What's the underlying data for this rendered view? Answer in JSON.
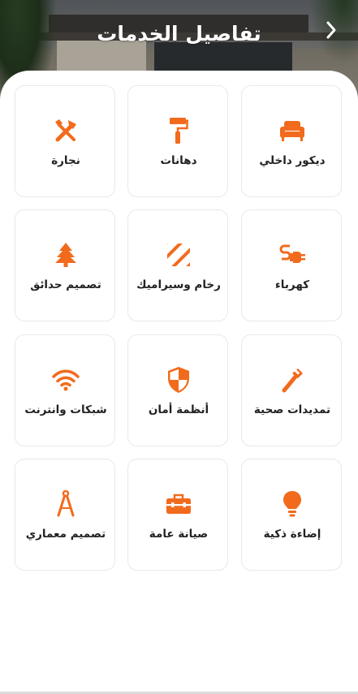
{
  "header": {
    "title": "تفاصيل الخدمات",
    "back_icon": "chevron-right-icon"
  },
  "colors": {
    "accent": "#f26b1d",
    "card_border": "#ece8e4",
    "text": "#222222"
  },
  "services": [
    {
      "label": "ديكور داخلي",
      "icon": "sofa-icon"
    },
    {
      "label": "دهانات",
      "icon": "paint-roller-icon"
    },
    {
      "label": "نجارة",
      "icon": "tools-icon"
    },
    {
      "label": "كهرباء",
      "icon": "plug-icon"
    },
    {
      "label": "رخام وسيراميك",
      "icon": "tiles-icon"
    },
    {
      "label": "تصميم حدائق",
      "icon": "tree-icon"
    },
    {
      "label": "تمديدات صحية",
      "icon": "wrench-icon"
    },
    {
      "label": "أنظمة أمان",
      "icon": "shield-icon"
    },
    {
      "label": "شبكات وانترنت",
      "icon": "wifi-icon"
    },
    {
      "label": "إضاءة ذكية",
      "icon": "lightbulb-icon"
    },
    {
      "label": "صيانة عامة",
      "icon": "toolbox-icon"
    },
    {
      "label": "تصميم معماري",
      "icon": "compass-icon"
    }
  ]
}
